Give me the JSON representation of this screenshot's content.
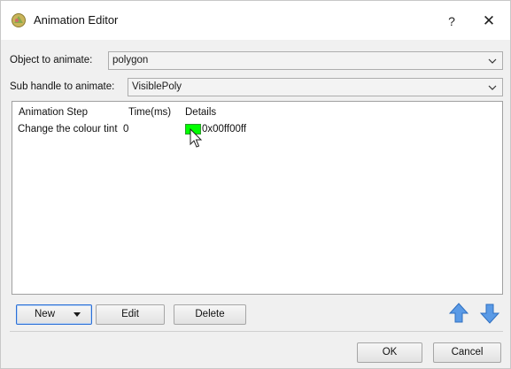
{
  "window": {
    "title": "Animation Editor",
    "help_label": "?",
    "close_label": "✕",
    "icon": "app-icon"
  },
  "object_field": {
    "label": "Object to animate:",
    "value": "polygon"
  },
  "sub_handle_field": {
    "label": "Sub handle to animate:",
    "value": "VisiblePoly"
  },
  "table": {
    "columns": [
      "Animation Step",
      "Time(ms)",
      "Details"
    ],
    "rows": [
      {
        "step": "Change the colour tint",
        "time": "0",
        "swatch_color": "#00ff00",
        "details": "0x00ff00ff"
      }
    ]
  },
  "buttons": {
    "new": "New",
    "edit": "Edit",
    "delete": "Delete",
    "ok": "OK",
    "cancel": "Cancel"
  },
  "colors": {
    "accent_arrow": "#5a9ae6",
    "swatch": "#00ff00"
  }
}
